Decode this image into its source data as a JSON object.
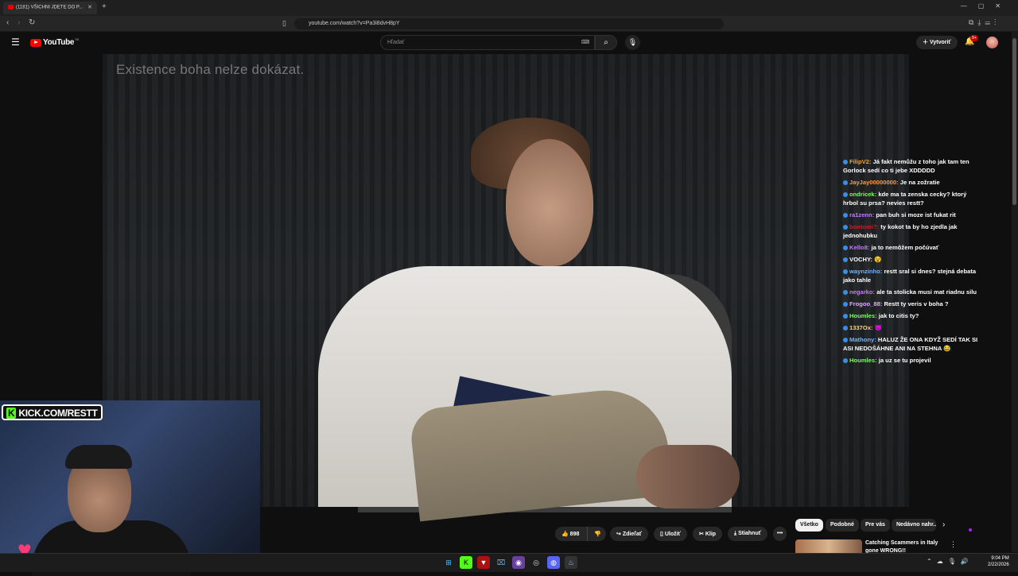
{
  "browser": {
    "tab_title": "(1181) VŠICHNI JDETE DO P...",
    "tab_close": "✕",
    "new_tab": "+",
    "window_controls": "—▢✕",
    "url": "youtube.com/watch?v=Pa3i8dvH8pY",
    "ext_icons": "⧉⤓☰⋮"
  },
  "youtube": {
    "logo_text": "YouTube",
    "logo_country": "SK",
    "search_placeholder": "Hľadať",
    "create_label": "Vytvoriť",
    "notification_count": "9+"
  },
  "video": {
    "subtitle": "Existence boha nelze dokázat."
  },
  "chat": [
    {
      "user": "FilipV2:",
      "color": "#f5a623",
      "text": "Já fakt nemůžu z toho jak tam ten Gorlock sedí co ti jebe XDDDDD"
    },
    {
      "user": "JayJay00000000:",
      "color": "#ff9c3d",
      "text": "Je na zožratie"
    },
    {
      "user": "ondricek:",
      "color": "#7cfc5a",
      "text": "kde ma ta zenska cecky? ktorý hrbol su prsa? nevies restt?"
    },
    {
      "user": "ra1zenn:",
      "color": "#c07cff",
      "text": "pan buh si moze ist fukat rit"
    },
    {
      "user": "bontomi?:",
      "color": "#d11a2a",
      "text": "ty kokot ta by ho zjedla jak jednohubku"
    },
    {
      "user": "Kello8:",
      "color": "#c07cff",
      "text": "ja to nemôžem počúvať"
    },
    {
      "user": "VOCHY:",
      "color": "#ffffff",
      "text": "😵"
    },
    {
      "user": "waynzinho:",
      "color": "#6fb4ff",
      "text": "restt sral si dnes? stejná debata jako tahle"
    },
    {
      "user": "negarko:",
      "color": "#c07cff",
      "text": "ale ta stolicka musi mat riadnu silu"
    },
    {
      "user": "Frogoo_88:",
      "color": "#e3a8ff",
      "text": "Restt ty veris v boha ?"
    },
    {
      "user": "Houmles:",
      "color": "#7cfc5a",
      "text": "jak to citis ty?"
    },
    {
      "user": "1337Ox:",
      "color": "#ffd36b",
      "text": "😈"
    },
    {
      "user": "Mathony:",
      "color": "#6fb4ff",
      "text": "HALUZ ŽE ONA KDYŽ SEDÍ TAK SI ASI NEDOŠÁHNE ANI NA STEHNA 😂"
    },
    {
      "user": "Houmles:",
      "color": "#7cfc5a",
      "text": "ja uz se tu projevil"
    }
  ],
  "webcam": {
    "banner_k": "K",
    "banner_text": "KICK.COM/RESTT"
  },
  "actions": {
    "likes": "898",
    "share": "Zdieľať",
    "save": "Uložiť",
    "clip": "Klip",
    "download": "Stiahnuť",
    "more": "•••"
  },
  "chips": [
    "Všetko",
    "Podobné",
    "Pre vás",
    "Nedávno nahr..."
  ],
  "recommendation": {
    "title": "Catching Scammers in Italy gone WRONG!!"
  },
  "taskbar": {
    "time": "9:04 PM",
    "date": "2/22/2026",
    "tray": "⌃☁🎙🔊"
  }
}
